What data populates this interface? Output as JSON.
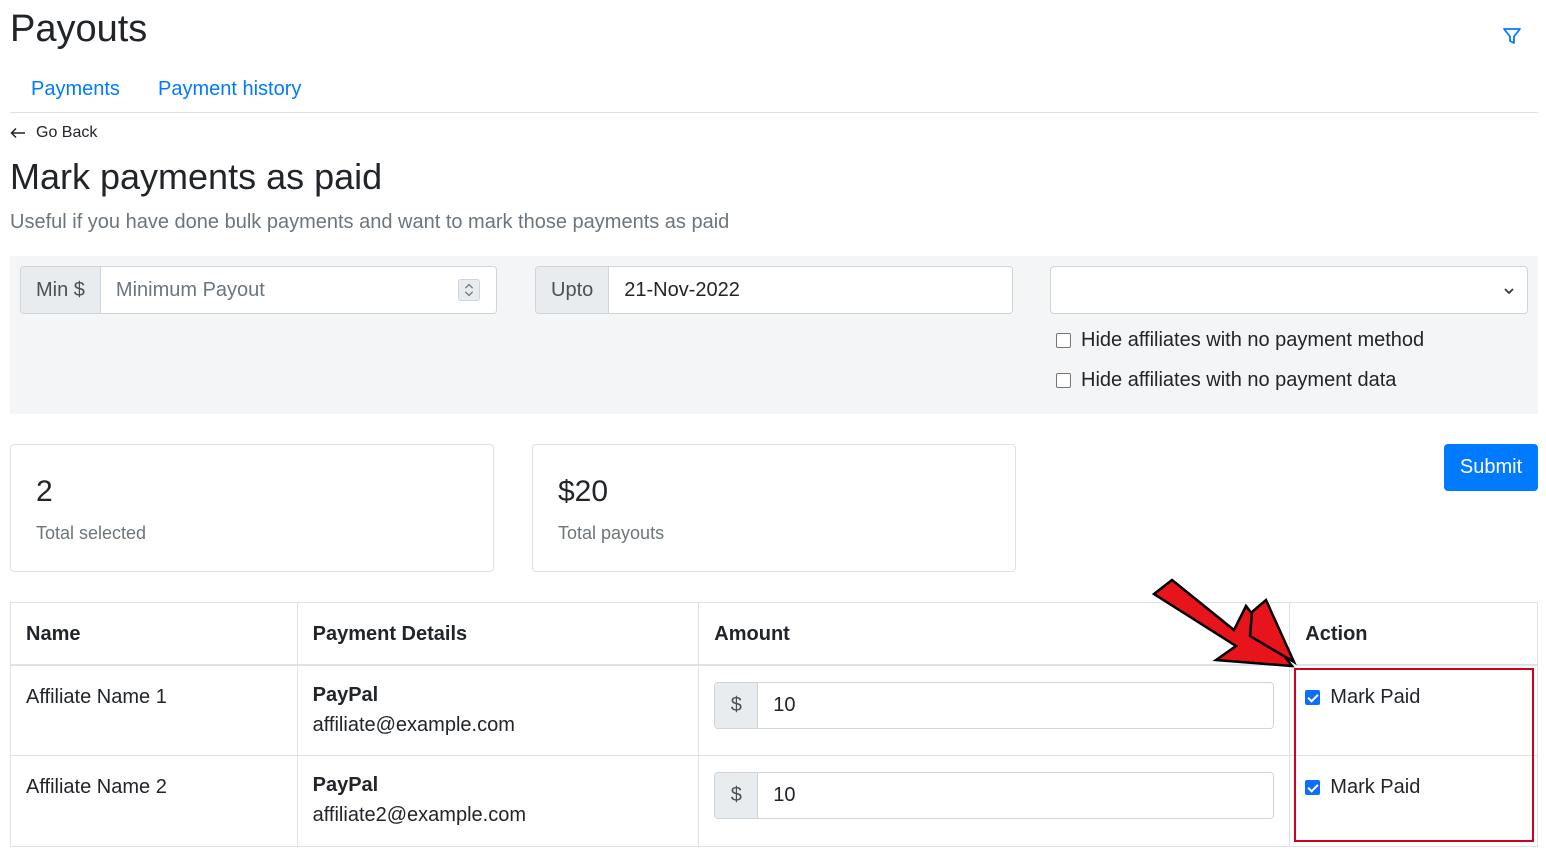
{
  "header": {
    "title": "Payouts",
    "filter_icon": "filter-icon"
  },
  "tabs": [
    {
      "label": "Payments"
    },
    {
      "label": "Payment history"
    }
  ],
  "back": {
    "label": "Go Back"
  },
  "section": {
    "title": "Mark payments as paid",
    "subtitle": "Useful if you have done bulk payments and want to mark those payments as paid"
  },
  "filters": {
    "min_prefix": "Min $",
    "min_placeholder": "Minimum Payout",
    "upto_prefix": "Upto",
    "upto_value": "21-Nov-2022",
    "select_value": "",
    "checkboxes": [
      {
        "label": "Hide affiliates with no payment method",
        "checked": false
      },
      {
        "label": "Hide affiliates with no payment data",
        "checked": false
      }
    ]
  },
  "stats": [
    {
      "value": "2",
      "label": "Total selected"
    },
    {
      "value": "$20",
      "label": "Total payouts"
    }
  ],
  "submit_label": "Submit",
  "table": {
    "headers": [
      "Name",
      "Payment Details",
      "Amount",
      "Action"
    ],
    "rows": [
      {
        "name": "Affiliate Name 1",
        "method": "PayPal",
        "email": "affiliate@example.com",
        "currency": "$",
        "amount": "10",
        "action": "Mark Paid",
        "checked": true
      },
      {
        "name": "Affiliate Name 2",
        "method": "PayPal",
        "email": "affiliate2@example.com",
        "currency": "$",
        "amount": "10",
        "action": "Mark Paid",
        "checked": true
      }
    ]
  },
  "colors": {
    "primary": "#007bff",
    "annotation": "#e8141c",
    "panel_bg": "#f4f5f7"
  }
}
